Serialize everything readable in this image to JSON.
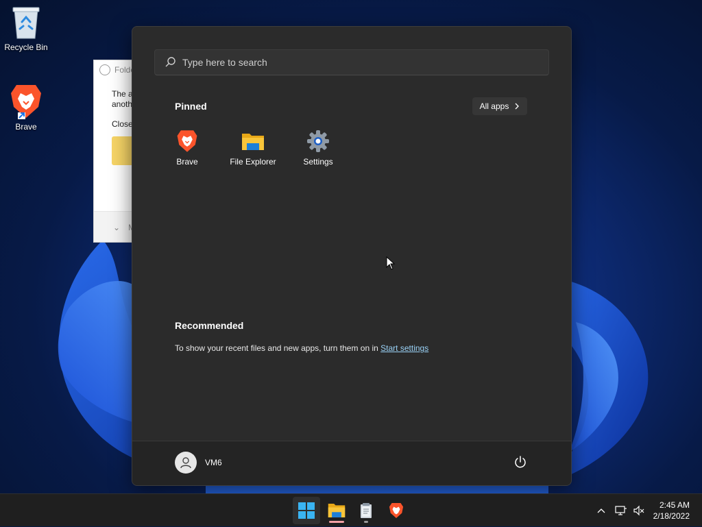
{
  "desktop": {
    "icons": [
      {
        "label": "Recycle Bin",
        "icon": "recycle-bin-icon"
      },
      {
        "label": "Brave",
        "icon": "brave-lion-icon",
        "shortcut": true
      }
    ]
  },
  "dialog": {
    "title": "Folde",
    "line1": "The a",
    "line2": "anoth",
    "close_text": "Close",
    "footer_text": "M"
  },
  "start_menu": {
    "search_placeholder": "Type here to search",
    "pinned_title": "Pinned",
    "all_apps_label": "All apps",
    "pinned": [
      {
        "label": "Brave",
        "icon": "brave-lion-icon"
      },
      {
        "label": "File Explorer",
        "icon": "folder-icon"
      },
      {
        "label": "Settings",
        "icon": "gear-icon"
      }
    ],
    "recommended_title": "Recommended",
    "recommended_text": "To show your recent files and new apps, turn them on in ",
    "recommended_link": "Start settings",
    "user_name": "VM6"
  },
  "taskbar": {
    "apps": [
      {
        "name": "Start",
        "icon": "windows-logo-icon",
        "active": true
      },
      {
        "name": "File Explorer",
        "icon": "folder-icon",
        "running": true
      },
      {
        "name": "Notepad",
        "icon": "notepad-icon",
        "running": true
      },
      {
        "name": "Brave",
        "icon": "brave-lion-icon",
        "running": false
      }
    ],
    "time": "2:45 AM",
    "date": "2/18/2022"
  },
  "colors": {
    "start_bg": "#2b2b2b",
    "accent_link": "#9ad2f7",
    "brave_orange": "#fb542b",
    "folder_yellow": "#f8c53a",
    "windows_blue": "#3ab4f2"
  }
}
